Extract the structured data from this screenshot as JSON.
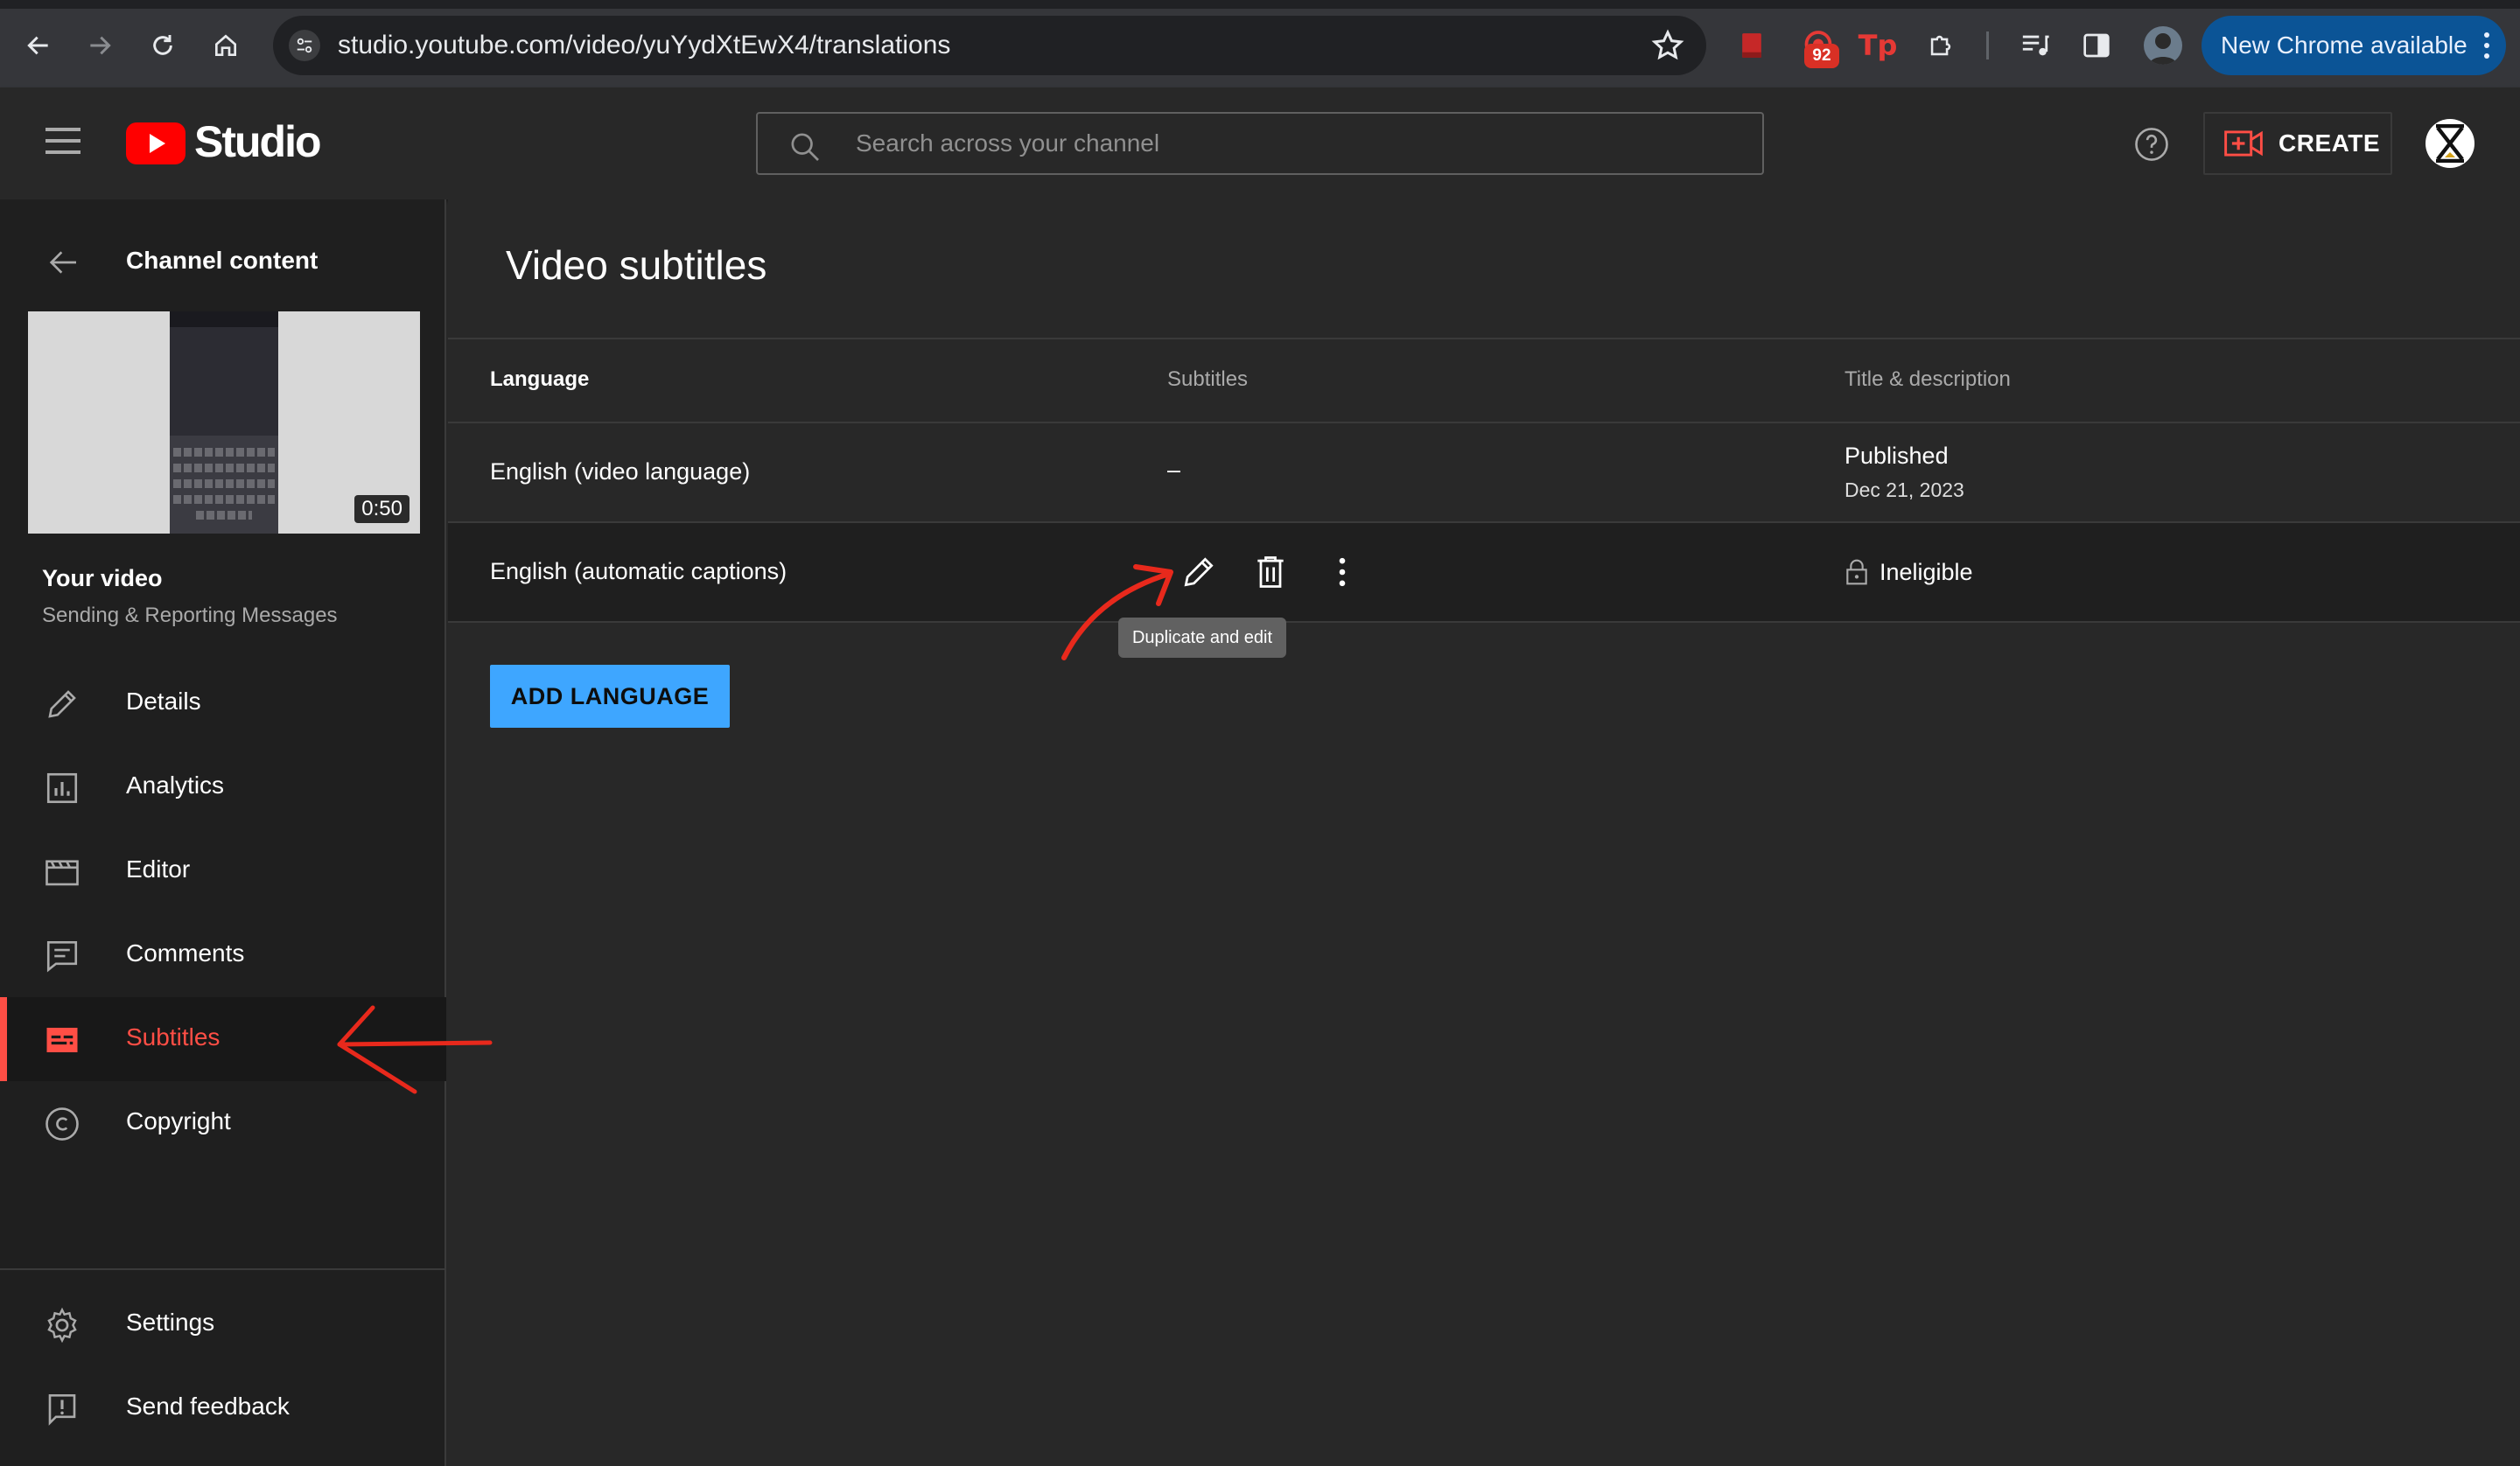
{
  "browser": {
    "url": "studio.youtube.com/video/yuYydXtEwX4/translations",
    "extension_badge": "92",
    "update_label": "New Chrome available"
  },
  "header": {
    "brand": "Studio",
    "search_placeholder": "Search across your channel",
    "create_label": "CREATE"
  },
  "sidebar": {
    "back_label": "Channel content",
    "thumbnail_duration": "0:50",
    "your_video_label": "Your video",
    "video_title": "Sending & Reporting Messages",
    "items": [
      {
        "label": "Details",
        "icon": "pencil-icon"
      },
      {
        "label": "Analytics",
        "icon": "analytics-icon"
      },
      {
        "label": "Editor",
        "icon": "clapperboard-icon"
      },
      {
        "label": "Comments",
        "icon": "comment-icon"
      },
      {
        "label": "Subtitles",
        "icon": "subtitles-icon",
        "active": true
      },
      {
        "label": "Copyright",
        "icon": "copyright-icon"
      }
    ],
    "bottom_items": [
      {
        "label": "Settings",
        "icon": "gear-icon"
      },
      {
        "label": "Send feedback",
        "icon": "feedback-icon"
      }
    ]
  },
  "main": {
    "title": "Video subtitles",
    "columns": [
      "Language",
      "Subtitles",
      "Title & description"
    ],
    "rows": [
      {
        "language": "English (video language)",
        "subtitles": "–",
        "status": "Published",
        "date": "Dec 21, 2023"
      },
      {
        "language": "English (automatic captions)",
        "title_status": "Ineligible"
      }
    ],
    "tooltip": "Duplicate and edit",
    "add_language_label": "ADD LANGUAGE"
  },
  "colors": {
    "accent_red": "#ff4e45",
    "brand_red": "#ff0000",
    "button_blue": "#3ea6ff",
    "annotation_red": "#e8291c",
    "update_pill": "#0b5496"
  }
}
